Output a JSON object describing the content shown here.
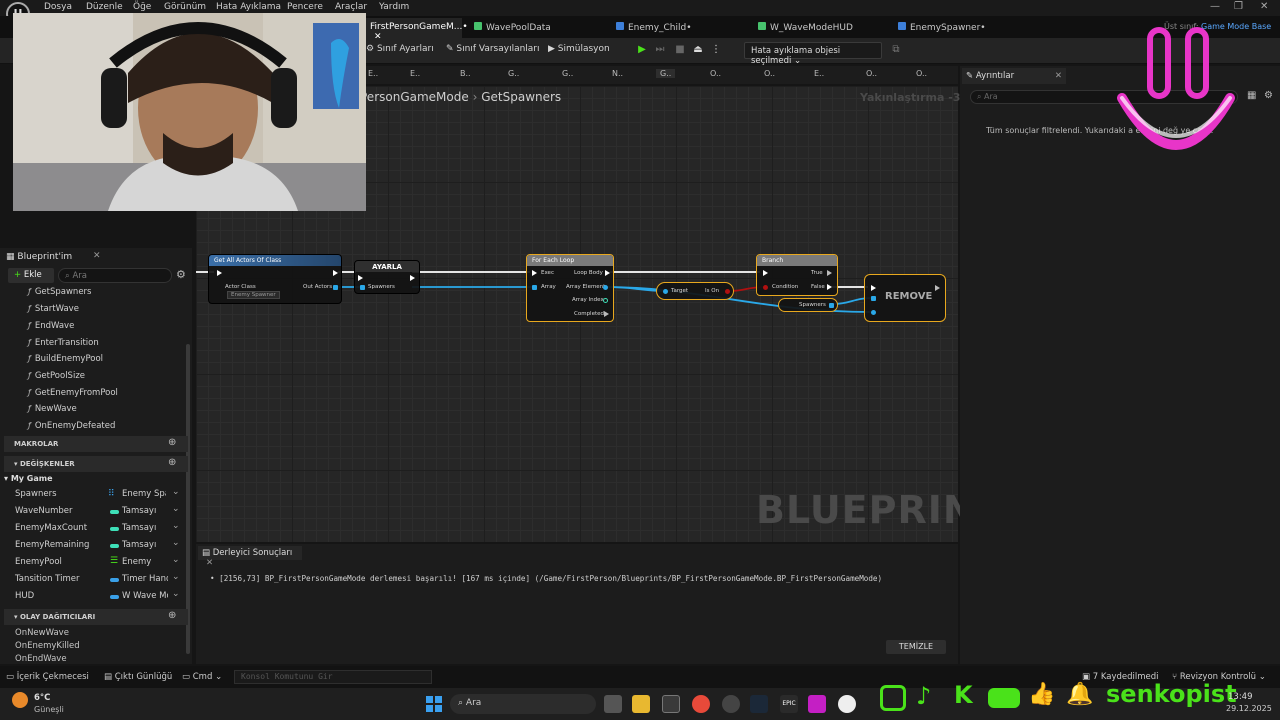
{
  "menu": [
    "Dosya",
    "Düzenle",
    "Öğe",
    "Görünüm",
    "Hata Ayıklama",
    "Pencere",
    "Araçlar",
    "Yardım"
  ],
  "tabs": {
    "items": [
      {
        "label": "FirstPersonGameM...•",
        "color": "#3d7fd9"
      },
      {
        "label": "WavePoolData",
        "color": "#47c26d"
      },
      {
        "label": "Enemy_Child•",
        "color": "#3d7fd9"
      },
      {
        "label": "W_WaveModeHUD",
        "color": "#47c26d"
      },
      {
        "label": "EnemySpawner•",
        "color": "#3d7fd9"
      }
    ],
    "parent_class_label": "Üst sınıf:",
    "parent_class_value": "Game Mode Base"
  },
  "toolbar": {
    "class_settings": "Sınıf Ayarları",
    "class_defaults": "Sınıf Varsayılanları",
    "simulation": "Simülasyon",
    "debug_object": "Hata ayıklama objesi seçilmedi"
  },
  "function_tabs": [
    "E..",
    "E..",
    "B..",
    "G..",
    "G..",
    "N..",
    "G..",
    "O..",
    "O..",
    "E..",
    "O..",
    "O.."
  ],
  "graph": {
    "breadcrumb_a": "PersonGameMode",
    "breadcrumb_b": "GetSpawners",
    "zoom": "Yakınlaştırma -3",
    "watermark": "BLUEPRINT"
  },
  "nodes": {
    "get_all": {
      "title": "Get All Actors Of Class",
      "actor_class": "Actor Class",
      "actor_value": "Enemy Spawner",
      "out_actors": "Out Actors"
    },
    "set": {
      "title": "AYARLA",
      "spawners": "Spawners"
    },
    "foreach": {
      "title": "For Each Loop",
      "exec": "Exec",
      "loop_body": "Loop Body",
      "array": "Array",
      "array_element": "Array Element",
      "array_index": "Array Index",
      "completed": "Completed"
    },
    "is_on": {
      "target": "Target",
      "label": "Is On"
    },
    "branch": {
      "title": "Branch",
      "true": "True",
      "condition": "Condition",
      "false": "False"
    },
    "spawners_get": {
      "label": "Spawners"
    },
    "remove": {
      "label": "REMOVE"
    }
  },
  "left_panel": {
    "title": "Blueprint'im",
    "add": "Ekle",
    "search_placeholder": "Ara",
    "functions": [
      "GetSpawners",
      "StartWave",
      "EndWave",
      "EnterTransition",
      "BuildEnemyPool",
      "GetPoolSize",
      "GetEnemyFromPool",
      "NewWave",
      "OnEnemyDefeated"
    ],
    "macros": "MAKROLAR",
    "variables": "DEĞİŞKENLER",
    "category": "My Game",
    "vars": [
      {
        "name": "Spawners",
        "type": "Enemy Spaw",
        "color": "#3aa0e8"
      },
      {
        "name": "WaveNumber",
        "type": "Tamsayı",
        "color": "#3ee0b8"
      },
      {
        "name": "EnemyMaxCount",
        "type": "Tamsayı",
        "color": "#3ee0b8"
      },
      {
        "name": "EnemyRemaining",
        "type": "Tamsayı",
        "color": "#3ee0b8"
      },
      {
        "name": "EnemyPool",
        "type": "Enemy",
        "color": "#3aa0e8"
      },
      {
        "name": "Tansition Timer",
        "type": "Timer Hand",
        "color": "#3aa0e8"
      },
      {
        "name": "HUD",
        "type": "W Wave Mo",
        "color": "#3aa0e8"
      }
    ],
    "dispatchers": "OLAY DAĞITICILARI",
    "dispatcher_items": [
      "OnNewWave",
      "OnEnemyKilled",
      "OnEndWave"
    ]
  },
  "details": {
    "title": "Ayrıntılar",
    "search_placeholder": "Ara",
    "message": "Tüm sonuçlar filtrelendi. Yukarıdaki a       elerini değ      ye çalış."
  },
  "compiler": {
    "title": "Derleyici Sonuçları",
    "message": "[2156,73] BP_FirstPersonGameMode derlemesi başarılı! [167 ms içinde] (/Game/FirstPerson/Blueprints/BP_FirstPersonGameMode.BP_FirstPersonGameMode)",
    "clear": "TEMİZLE"
  },
  "statusbar": {
    "content_drawer": "İçerik Çekmecesi",
    "output_log": "Çıktı Günlüğü",
    "cmd": "Cmd",
    "console_placeholder": "Konsol Komutunu Gir",
    "saved": "7 Kaydedilmedi",
    "revision": "Revizyon Kontrolü"
  },
  "taskbar": {
    "temp": "6°C",
    "weather": "Güneşli",
    "search": "Ara",
    "time": "13:49",
    "date": "29.12.2025"
  },
  "overlay": {
    "social_name": "senkopist"
  }
}
